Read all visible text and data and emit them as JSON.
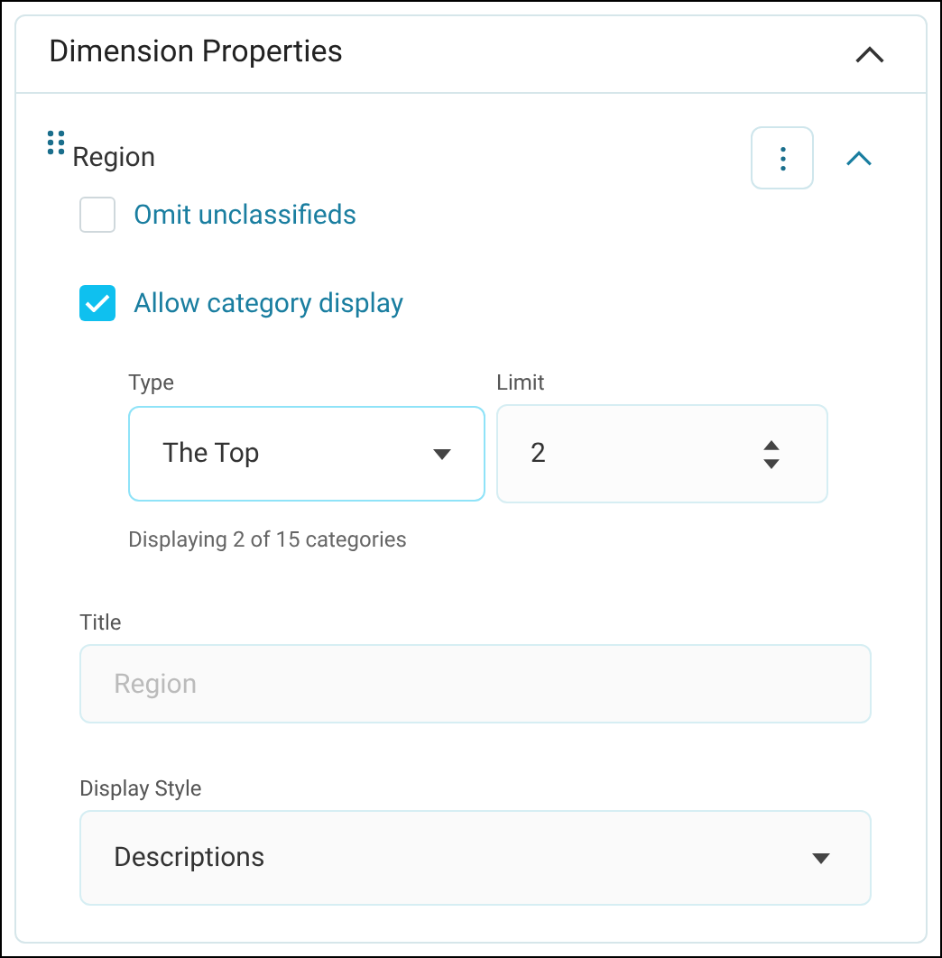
{
  "panel": {
    "title": "Dimension Properties",
    "expanded": true
  },
  "dimension": {
    "name": "Region",
    "expanded": true
  },
  "options": [
    {
      "label": "Omit unclassifieds",
      "checked": false
    },
    {
      "label": "Allow category display",
      "checked": true
    }
  ],
  "type_field": {
    "label": "Type",
    "value": "The Top"
  },
  "limit_field": {
    "label": "Limit",
    "value": "2"
  },
  "helper": "Displaying 2 of 15 categories",
  "title_field": {
    "label": "Title",
    "placeholder": "Region"
  },
  "display_style": {
    "label": "Display Style",
    "value": "Descriptions"
  }
}
